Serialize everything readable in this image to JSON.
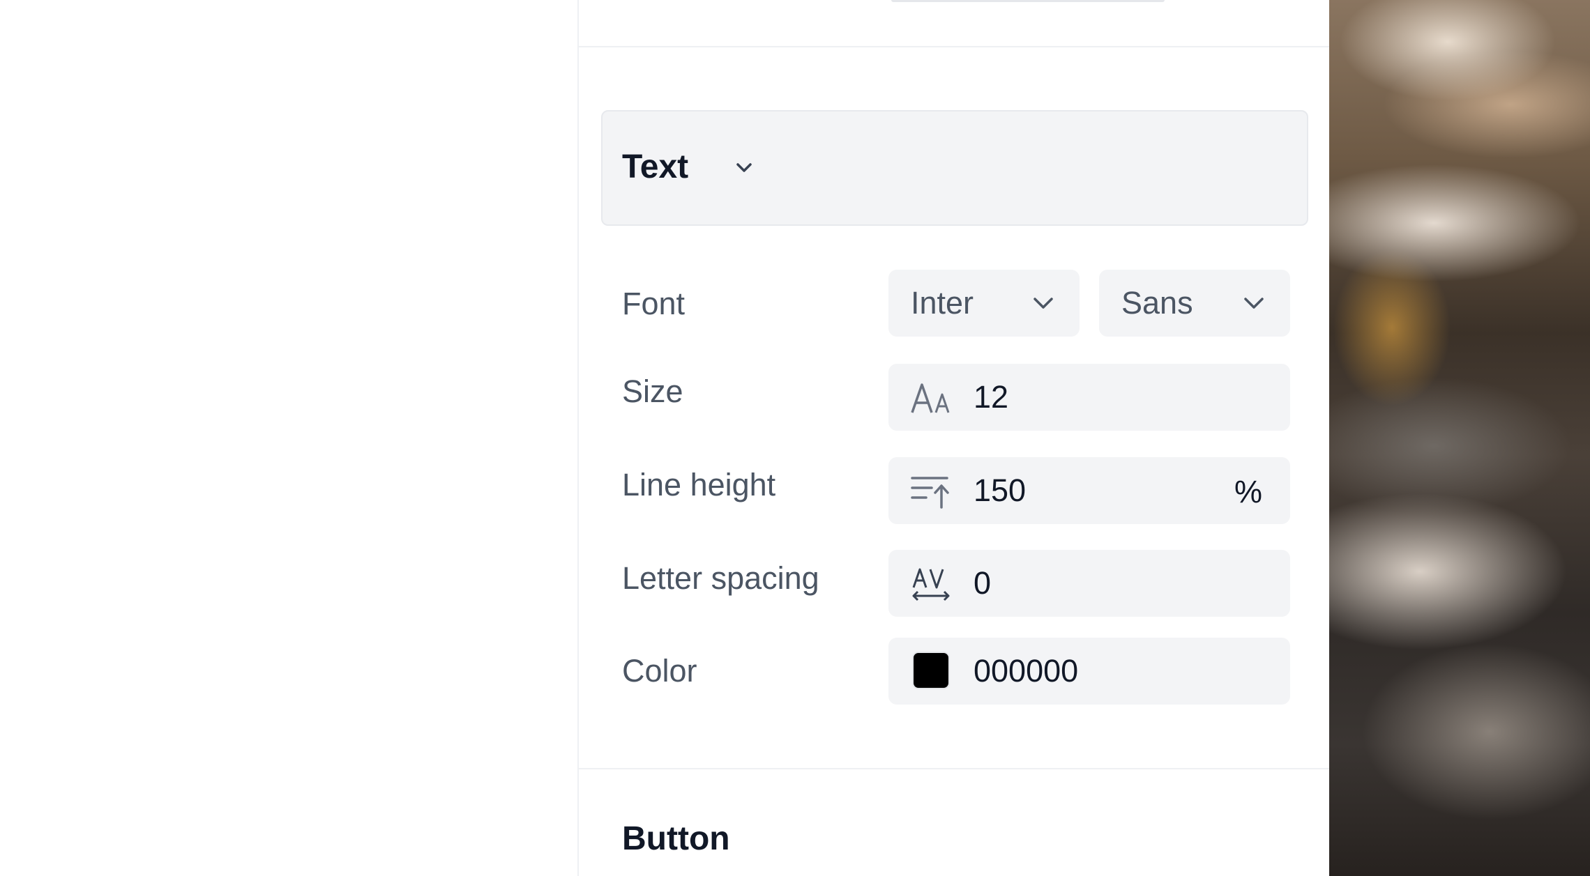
{
  "text_section": {
    "title": "Text"
  },
  "rows": {
    "font": {
      "label": "Font",
      "family_value": "Inter",
      "category_value": "Sans"
    },
    "size": {
      "label": "Size",
      "value": "12",
      "icon": "font-size-icon"
    },
    "line_height": {
      "label": "Line height",
      "value": "150",
      "unit": "%",
      "icon": "line-height-icon"
    },
    "letter_spacing": {
      "label": "Letter spacing",
      "value": "0",
      "icon": "letter-spacing-icon"
    },
    "color": {
      "label": "Color",
      "value": "000000",
      "swatch_color": "#000000"
    }
  },
  "button_section": {
    "title": "Button"
  },
  "colors": {
    "panel_background": "#ffffff",
    "field_background": "#f3f4f6",
    "label_text": "#4b5563",
    "heading_text": "#111827"
  }
}
